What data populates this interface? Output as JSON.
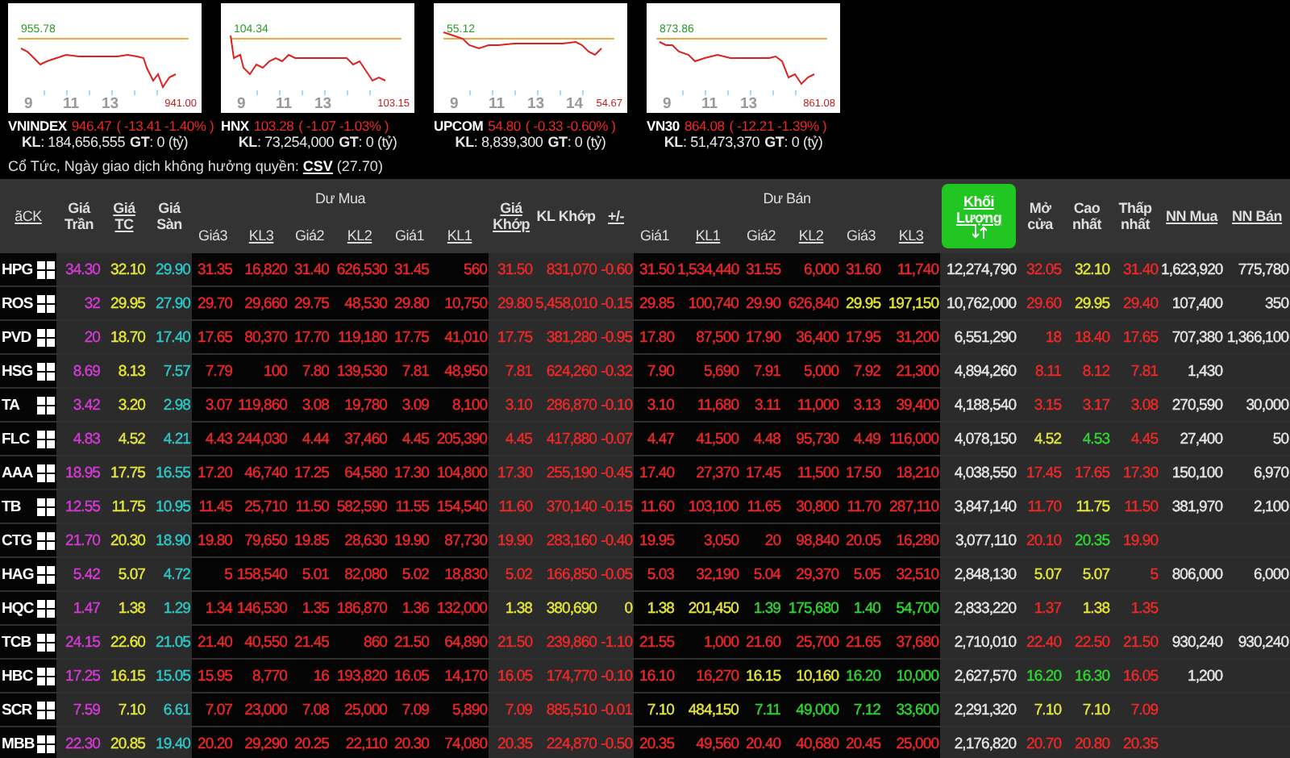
{
  "indices": [
    {
      "name": "VNINDEX",
      "value": "946.47",
      "change": "( -13.41  -1.40% )",
      "volume": "**KL**: 184,656,555",
      "turnover": "**GT**: 0 (tỷ)",
      "high": "955.78",
      "low": "941.00",
      "ticks": [
        "9",
        "11",
        "13"
      ]
    },
    {
      "name": "HNX",
      "value": "103.28",
      "change": "( -1.07  -1.03% )",
      "volume": "**KL**: 73,254,000",
      "turnover": "**GT**: 0 (tỷ)",
      "high": "104.34",
      "low": "103.15",
      "ticks": [
        "9",
        "11",
        "13"
      ]
    },
    {
      "name": "UPCOM",
      "value": "54.80",
      "change": "( -0.33  -0.60% )",
      "volume": "**KL**: 8,839,300",
      "turnover": "**GT**: 0 (tỷ)",
      "high": "55.12",
      "low": "54.67",
      "ticks": [
        "9",
        "11",
        "13",
        "14"
      ]
    },
    {
      "name": "VN30",
      "value": "864.08",
      "change": "( -12.21  -1.39% )",
      "volume": "**KL**: 51,473,370",
      "turnover": "**GT**: 0 (tỷ)",
      "high": "873.86",
      "low": "861.08",
      "ticks": [
        "9",
        "11",
        "13"
      ]
    }
  ],
  "notice": {
    "text": "Cổ Tức, Ngày giao dịch không hưởng quyền:",
    "link": "CSV",
    "after": "(27.70)"
  },
  "table": {
    "header": [
      {
        "kind": "ticker",
        "label": "ãCK",
        "link": true,
        "sorted": false
      },
      {
        "kind": "single",
        "label": "Giá Trần",
        "link": false,
        "sorted": false
      },
      {
        "kind": "single",
        "label": "Giá TC",
        "link": true,
        "sorted": false
      },
      {
        "kind": "single",
        "label": "Giá Sàn",
        "link": false,
        "sorted": false
      },
      {
        "kind": "group",
        "label": "Dư Mua",
        "sub": [
          {
            "label": "Giá3",
            "link": false
          },
          {
            "label": "KL3",
            "link": true
          },
          {
            "label": "Giá2",
            "link": false
          },
          {
            "label": "KL2",
            "link": true
          },
          {
            "label": "Giá1",
            "link": false
          },
          {
            "label": "KL1",
            "link": true
          }
        ]
      },
      {
        "kind": "single",
        "label": "Giá Khớp",
        "link": true,
        "sorted": false
      },
      {
        "kind": "single",
        "label": "KL Khớp",
        "link": false,
        "sorted": false
      },
      {
        "kind": "single",
        "label": "+/-",
        "link": true,
        "sorted": false
      },
      {
        "kind": "group",
        "label": "Dư Bán",
        "sub": [
          {
            "label": "Giá1",
            "link": false
          },
          {
            "label": "KL1",
            "link": true
          },
          {
            "label": "Giá2",
            "link": false
          },
          {
            "label": "KL2",
            "link": true
          },
          {
            "label": "Giá3",
            "link": false
          },
          {
            "label": "KL3",
            "link": true
          }
        ]
      },
      {
        "kind": "single",
        "label": "Khối Lượng",
        "link": true,
        "sorted": true
      },
      {
        "kind": "single",
        "label": "Mở cửa",
        "link": false,
        "sorted": false
      },
      {
        "kind": "single",
        "label": "Cao nhất",
        "link": false,
        "sorted": false
      },
      {
        "kind": "single",
        "label": "Thấp nhất",
        "link": false,
        "sorted": false
      },
      {
        "kind": "single",
        "label": "NN Mua",
        "link": true,
        "sorted": false
      },
      {
        "kind": "single",
        "label": "NN Bán",
        "link": true,
        "sorted": false
      }
    ],
    "rows": [
      {
        "ticker": "HPG",
        "cells": [
          {
            "text": "34.30",
            "color": "#d63ad6"
          },
          {
            "text": "32.10",
            "color": "#e6e63c"
          },
          {
            "text": "29.90",
            "color": "#2ec8c8"
          },
          {
            "text": "31.35",
            "color": "#f02828"
          },
          {
            "text": "16,820",
            "color": "#f02828"
          },
          {
            "text": "31.40",
            "color": "#f02828"
          },
          {
            "text": "626,530",
            "color": "#f02828"
          },
          {
            "text": "31.45",
            "color": "#f02828"
          },
          {
            "text": "560",
            "color": "#f02828"
          },
          {
            "text": "31.50",
            "color": "#f02828"
          },
          {
            "text": "831,070",
            "color": "#f02828"
          },
          {
            "text": "-0.60",
            "color": "#f02828"
          },
          {
            "text": "31.50",
            "color": "#f02828"
          },
          {
            "text": "1,534,440",
            "color": "#f02828"
          },
          {
            "text": "31.55",
            "color": "#f02828"
          },
          {
            "text": "6,000",
            "color": "#f02828"
          },
          {
            "text": "31.60",
            "color": "#f02828"
          },
          {
            "text": "11,740",
            "color": "#f02828"
          },
          {
            "text": "12,274,790",
            "color": "#e6e6e6"
          },
          {
            "text": "32.05",
            "color": "#f02828"
          },
          {
            "text": "32.10",
            "color": "#e6e63c"
          },
          {
            "text": "31.40",
            "color": "#f02828"
          },
          {
            "text": "1,623,920",
            "color": "#e6e6e6"
          },
          {
            "text": "775,780",
            "color": "#e6e6e6"
          }
        ]
      },
      {
        "ticker": "ROS",
        "cells": [
          {
            "text": "32",
            "color": "#d63ad6"
          },
          {
            "text": "29.95",
            "color": "#e6e63c"
          },
          {
            "text": "27.90",
            "color": "#2ec8c8"
          },
          {
            "text": "29.70",
            "color": "#f02828"
          },
          {
            "text": "29,660",
            "color": "#f02828"
          },
          {
            "text": "29.75",
            "color": "#f02828"
          },
          {
            "text": "48,530",
            "color": "#f02828"
          },
          {
            "text": "29.80",
            "color": "#f02828"
          },
          {
            "text": "10,750",
            "color": "#f02828"
          },
          {
            "text": "29.80",
            "color": "#f02828"
          },
          {
            "text": "5,458,010",
            "color": "#f02828"
          },
          {
            "text": "-0.15",
            "color": "#f02828"
          },
          {
            "text": "29.85",
            "color": "#f02828"
          },
          {
            "text": "100,740",
            "color": "#f02828"
          },
          {
            "text": "29.90",
            "color": "#f02828"
          },
          {
            "text": "626,840",
            "color": "#f02828"
          },
          {
            "text": "29.95",
            "color": "#e6e63c"
          },
          {
            "text": "197,150",
            "color": "#e6e63c"
          },
          {
            "text": "10,762,000",
            "color": "#e6e6e6"
          },
          {
            "text": "29.60",
            "color": "#f02828"
          },
          {
            "text": "29.95",
            "color": "#e6e63c"
          },
          {
            "text": "29.40",
            "color": "#f02828"
          },
          {
            "text": "107,400",
            "color": "#e6e6e6"
          },
          {
            "text": "350",
            "color": "#e6e6e6"
          }
        ]
      },
      {
        "ticker": "PVD",
        "cells": [
          {
            "text": "20",
            "color": "#d63ad6"
          },
          {
            "text": "18.70",
            "color": "#e6e63c"
          },
          {
            "text": "17.40",
            "color": "#2ec8c8"
          },
          {
            "text": "17.65",
            "color": "#f02828"
          },
          {
            "text": "80,370",
            "color": "#f02828"
          },
          {
            "text": "17.70",
            "color": "#f02828"
          },
          {
            "text": "119,180",
            "color": "#f02828"
          },
          {
            "text": "17.75",
            "color": "#f02828"
          },
          {
            "text": "41,010",
            "color": "#f02828"
          },
          {
            "text": "17.75",
            "color": "#f02828"
          },
          {
            "text": "381,280",
            "color": "#f02828"
          },
          {
            "text": "-0.95",
            "color": "#f02828"
          },
          {
            "text": "17.80",
            "color": "#f02828"
          },
          {
            "text": "87,500",
            "color": "#f02828"
          },
          {
            "text": "17.90",
            "color": "#f02828"
          },
          {
            "text": "36,400",
            "color": "#f02828"
          },
          {
            "text": "17.95",
            "color": "#f02828"
          },
          {
            "text": "31,200",
            "color": "#f02828"
          },
          {
            "text": "6,551,290",
            "color": "#e6e6e6"
          },
          {
            "text": "18",
            "color": "#f02828"
          },
          {
            "text": "18.40",
            "color": "#f02828"
          },
          {
            "text": "17.65",
            "color": "#f02828"
          },
          {
            "text": "707,380",
            "color": "#e6e6e6"
          },
          {
            "text": "1,366,100",
            "color": "#e6e6e6"
          }
        ]
      },
      {
        "ticker": "HSG",
        "cells": [
          {
            "text": "8.69",
            "color": "#d63ad6"
          },
          {
            "text": "8.13",
            "color": "#e6e63c"
          },
          {
            "text": "7.57",
            "color": "#2ec8c8"
          },
          {
            "text": "7.79",
            "color": "#f02828"
          },
          {
            "text": "100",
            "color": "#f02828"
          },
          {
            "text": "7.80",
            "color": "#f02828"
          },
          {
            "text": "139,530",
            "color": "#f02828"
          },
          {
            "text": "7.81",
            "color": "#f02828"
          },
          {
            "text": "48,950",
            "color": "#f02828"
          },
          {
            "text": "7.81",
            "color": "#f02828"
          },
          {
            "text": "624,260",
            "color": "#f02828"
          },
          {
            "text": "-0.32",
            "color": "#f02828"
          },
          {
            "text": "7.90",
            "color": "#f02828"
          },
          {
            "text": "5,690",
            "color": "#f02828"
          },
          {
            "text": "7.91",
            "color": "#f02828"
          },
          {
            "text": "5,000",
            "color": "#f02828"
          },
          {
            "text": "7.92",
            "color": "#f02828"
          },
          {
            "text": "21,300",
            "color": "#f02828"
          },
          {
            "text": "4,894,260",
            "color": "#e6e6e6"
          },
          {
            "text": "8.11",
            "color": "#f02828"
          },
          {
            "text": "8.12",
            "color": "#f02828"
          },
          {
            "text": "7.81",
            "color": "#f02828"
          },
          {
            "text": "1,430",
            "color": "#e6e6e6"
          },
          null
        ]
      },
      {
        "ticker": "TA",
        "cells": [
          {
            "text": "3.42",
            "color": "#d63ad6"
          },
          {
            "text": "3.20",
            "color": "#e6e63c"
          },
          {
            "text": "2.98",
            "color": "#2ec8c8"
          },
          {
            "text": "3.07",
            "color": "#f02828"
          },
          {
            "text": "119,860",
            "color": "#f02828"
          },
          {
            "text": "3.08",
            "color": "#f02828"
          },
          {
            "text": "19,780",
            "color": "#f02828"
          },
          {
            "text": "3.09",
            "color": "#f02828"
          },
          {
            "text": "8,100",
            "color": "#f02828"
          },
          {
            "text": "3.10",
            "color": "#f02828"
          },
          {
            "text": "286,870",
            "color": "#f02828"
          },
          {
            "text": "-0.10",
            "color": "#f02828"
          },
          {
            "text": "3.10",
            "color": "#f02828"
          },
          {
            "text": "11,680",
            "color": "#f02828"
          },
          {
            "text": "3.11",
            "color": "#f02828"
          },
          {
            "text": "11,000",
            "color": "#f02828"
          },
          {
            "text": "3.13",
            "color": "#f02828"
          },
          {
            "text": "39,400",
            "color": "#f02828"
          },
          {
            "text": "4,188,540",
            "color": "#e6e6e6"
          },
          {
            "text": "3.15",
            "color": "#f02828"
          },
          {
            "text": "3.17",
            "color": "#f02828"
          },
          {
            "text": "3.08",
            "color": "#f02828"
          },
          {
            "text": "270,590",
            "color": "#e6e6e6"
          },
          {
            "text": "30,000",
            "color": "#e6e6e6"
          }
        ]
      },
      {
        "ticker": "FLC",
        "cells": [
          {
            "text": "4.83",
            "color": "#d63ad6"
          },
          {
            "text": "4.52",
            "color": "#e6e63c"
          },
          {
            "text": "4.21",
            "color": "#2ec8c8"
          },
          {
            "text": "4.43",
            "color": "#f02828"
          },
          {
            "text": "244,030",
            "color": "#f02828"
          },
          {
            "text": "4.44",
            "color": "#f02828"
          },
          {
            "text": "37,460",
            "color": "#f02828"
          },
          {
            "text": "4.45",
            "color": "#f02828"
          },
          {
            "text": "205,390",
            "color": "#f02828"
          },
          {
            "text": "4.45",
            "color": "#f02828"
          },
          {
            "text": "417,880",
            "color": "#f02828"
          },
          {
            "text": "-0.07",
            "color": "#f02828"
          },
          {
            "text": "4.47",
            "color": "#f02828"
          },
          {
            "text": "41,500",
            "color": "#f02828"
          },
          {
            "text": "4.48",
            "color": "#f02828"
          },
          {
            "text": "95,730",
            "color": "#f02828"
          },
          {
            "text": "4.49",
            "color": "#f02828"
          },
          {
            "text": "116,000",
            "color": "#f02828"
          },
          {
            "text": "4,078,150",
            "color": "#e6e6e6"
          },
          {
            "text": "4.52",
            "color": "#e6e63c"
          },
          {
            "text": "4.53",
            "color": "#2fd82f"
          },
          {
            "text": "4.45",
            "color": "#f02828"
          },
          {
            "text": "27,400",
            "color": "#e6e6e6"
          },
          {
            "text": "50",
            "color": "#e6e6e6"
          }
        ]
      },
      {
        "ticker": "AAA",
        "cells": [
          {
            "text": "18.95",
            "color": "#d63ad6"
          },
          {
            "text": "17.75",
            "color": "#e6e63c"
          },
          {
            "text": "16.55",
            "color": "#2ec8c8"
          },
          {
            "text": "17.20",
            "color": "#f02828"
          },
          {
            "text": "46,740",
            "color": "#f02828"
          },
          {
            "text": "17.25",
            "color": "#f02828"
          },
          {
            "text": "64,580",
            "color": "#f02828"
          },
          {
            "text": "17.30",
            "color": "#f02828"
          },
          {
            "text": "104,800",
            "color": "#f02828"
          },
          {
            "text": "17.30",
            "color": "#f02828"
          },
          {
            "text": "255,190",
            "color": "#f02828"
          },
          {
            "text": "-0.45",
            "color": "#f02828"
          },
          {
            "text": "17.40",
            "color": "#f02828"
          },
          {
            "text": "27,370",
            "color": "#f02828"
          },
          {
            "text": "17.45",
            "color": "#f02828"
          },
          {
            "text": "11,500",
            "color": "#f02828"
          },
          {
            "text": "17.50",
            "color": "#f02828"
          },
          {
            "text": "18,210",
            "color": "#f02828"
          },
          {
            "text": "4,038,550",
            "color": "#e6e6e6"
          },
          {
            "text": "17.45",
            "color": "#f02828"
          },
          {
            "text": "17.65",
            "color": "#f02828"
          },
          {
            "text": "17.30",
            "color": "#f02828"
          },
          {
            "text": "150,100",
            "color": "#e6e6e6"
          },
          {
            "text": "6,970",
            "color": "#e6e6e6"
          }
        ]
      },
      {
        "ticker": "TB",
        "cells": [
          {
            "text": "12.55",
            "color": "#d63ad6"
          },
          {
            "text": "11.75",
            "color": "#e6e63c"
          },
          {
            "text": "10.95",
            "color": "#2ec8c8"
          },
          {
            "text": "11.45",
            "color": "#f02828"
          },
          {
            "text": "25,710",
            "color": "#f02828"
          },
          {
            "text": "11.50",
            "color": "#f02828"
          },
          {
            "text": "582,590",
            "color": "#f02828"
          },
          {
            "text": "11.55",
            "color": "#f02828"
          },
          {
            "text": "154,540",
            "color": "#f02828"
          },
          {
            "text": "11.60",
            "color": "#f02828"
          },
          {
            "text": "370,140",
            "color": "#f02828"
          },
          {
            "text": "-0.15",
            "color": "#f02828"
          },
          {
            "text": "11.60",
            "color": "#f02828"
          },
          {
            "text": "103,100",
            "color": "#f02828"
          },
          {
            "text": "11.65",
            "color": "#f02828"
          },
          {
            "text": "30,800",
            "color": "#f02828"
          },
          {
            "text": "11.70",
            "color": "#f02828"
          },
          {
            "text": "287,110",
            "color": "#f02828"
          },
          {
            "text": "3,847,140",
            "color": "#e6e6e6"
          },
          {
            "text": "11.70",
            "color": "#f02828"
          },
          {
            "text": "11.75",
            "color": "#e6e63c"
          },
          {
            "text": "11.50",
            "color": "#f02828"
          },
          {
            "text": "381,970",
            "color": "#e6e6e6"
          },
          {
            "text": "2,100",
            "color": "#e6e6e6"
          }
        ]
      },
      {
        "ticker": "CTG",
        "cells": [
          {
            "text": "21.70",
            "color": "#d63ad6"
          },
          {
            "text": "20.30",
            "color": "#e6e63c"
          },
          {
            "text": "18.90",
            "color": "#2ec8c8"
          },
          {
            "text": "19.80",
            "color": "#f02828"
          },
          {
            "text": "79,650",
            "color": "#f02828"
          },
          {
            "text": "19.85",
            "color": "#f02828"
          },
          {
            "text": "28,630",
            "color": "#f02828"
          },
          {
            "text": "19.90",
            "color": "#f02828"
          },
          {
            "text": "87,730",
            "color": "#f02828"
          },
          {
            "text": "19.90",
            "color": "#f02828"
          },
          {
            "text": "283,160",
            "color": "#f02828"
          },
          {
            "text": "-0.40",
            "color": "#f02828"
          },
          {
            "text": "19.95",
            "color": "#f02828"
          },
          {
            "text": "3,050",
            "color": "#f02828"
          },
          {
            "text": "20",
            "color": "#f02828"
          },
          {
            "text": "98,840",
            "color": "#f02828"
          },
          {
            "text": "20.05",
            "color": "#f02828"
          },
          {
            "text": "16,280",
            "color": "#f02828"
          },
          {
            "text": "3,077,110",
            "color": "#e6e6e6"
          },
          {
            "text": "20.10",
            "color": "#f02828"
          },
          {
            "text": "20.35",
            "color": "#2fd82f"
          },
          {
            "text": "19.90",
            "color": "#f02828"
          },
          null,
          null
        ]
      },
      {
        "ticker": "HAG",
        "cells": [
          {
            "text": "5.42",
            "color": "#d63ad6"
          },
          {
            "text": "5.07",
            "color": "#e6e63c"
          },
          {
            "text": "4.72",
            "color": "#2ec8c8"
          },
          {
            "text": "5",
            "color": "#f02828"
          },
          {
            "text": "158,540",
            "color": "#f02828"
          },
          {
            "text": "5.01",
            "color": "#f02828"
          },
          {
            "text": "82,080",
            "color": "#f02828"
          },
          {
            "text": "5.02",
            "color": "#f02828"
          },
          {
            "text": "18,830",
            "color": "#f02828"
          },
          {
            "text": "5.02",
            "color": "#f02828"
          },
          {
            "text": "166,850",
            "color": "#f02828"
          },
          {
            "text": "-0.05",
            "color": "#f02828"
          },
          {
            "text": "5.03",
            "color": "#f02828"
          },
          {
            "text": "32,190",
            "color": "#f02828"
          },
          {
            "text": "5.04",
            "color": "#f02828"
          },
          {
            "text": "29,370",
            "color": "#f02828"
          },
          {
            "text": "5.05",
            "color": "#f02828"
          },
          {
            "text": "32,510",
            "color": "#f02828"
          },
          {
            "text": "2,848,130",
            "color": "#e6e6e6"
          },
          {
            "text": "5.07",
            "color": "#e6e63c"
          },
          {
            "text": "5.07",
            "color": "#e6e63c"
          },
          {
            "text": "5",
            "color": "#f02828"
          },
          {
            "text": "806,000",
            "color": "#e6e6e6"
          },
          {
            "text": "6,000",
            "color": "#e6e6e6"
          }
        ]
      },
      {
        "ticker": "HQC",
        "cells": [
          {
            "text": "1.47",
            "color": "#d63ad6"
          },
          {
            "text": "1.38",
            "color": "#e6e63c"
          },
          {
            "text": "1.29",
            "color": "#2ec8c8"
          },
          {
            "text": "1.34",
            "color": "#f02828"
          },
          {
            "text": "146,530",
            "color": "#f02828"
          },
          {
            "text": "1.35",
            "color": "#f02828"
          },
          {
            "text": "186,870",
            "color": "#f02828"
          },
          {
            "text": "1.36",
            "color": "#f02828"
          },
          {
            "text": "132,000",
            "color": "#f02828"
          },
          {
            "text": "1.38",
            "color": "#e6e63c"
          },
          {
            "text": "380,690",
            "color": "#e6e63c"
          },
          {
            "text": "0",
            "color": "#e6e63c"
          },
          {
            "text": "1.38",
            "color": "#e6e63c"
          },
          {
            "text": "201,450",
            "color": "#e6e63c"
          },
          {
            "text": "1.39",
            "color": "#2fd82f"
          },
          {
            "text": "175,680",
            "color": "#2fd82f"
          },
          {
            "text": "1.40",
            "color": "#2fd82f"
          },
          {
            "text": "54,700",
            "color": "#2fd82f"
          },
          {
            "text": "2,833,220",
            "color": "#e6e6e6"
          },
          {
            "text": "1.37",
            "color": "#f02828"
          },
          {
            "text": "1.38",
            "color": "#e6e63c"
          },
          {
            "text": "1.35",
            "color": "#f02828"
          },
          null,
          null
        ]
      },
      {
        "ticker": "TCB",
        "cells": [
          {
            "text": "24.15",
            "color": "#d63ad6"
          },
          {
            "text": "22.60",
            "color": "#e6e63c"
          },
          {
            "text": "21.05",
            "color": "#2ec8c8"
          },
          {
            "text": "21.40",
            "color": "#f02828"
          },
          {
            "text": "40,550",
            "color": "#f02828"
          },
          {
            "text": "21.45",
            "color": "#f02828"
          },
          {
            "text": "860",
            "color": "#f02828"
          },
          {
            "text": "21.50",
            "color": "#f02828"
          },
          {
            "text": "64,890",
            "color": "#f02828"
          },
          {
            "text": "21.50",
            "color": "#f02828"
          },
          {
            "text": "239,860",
            "color": "#f02828"
          },
          {
            "text": "-1.10",
            "color": "#f02828"
          },
          {
            "text": "21.55",
            "color": "#f02828"
          },
          {
            "text": "1,000",
            "color": "#f02828"
          },
          {
            "text": "21.60",
            "color": "#f02828"
          },
          {
            "text": "25,700",
            "color": "#f02828"
          },
          {
            "text": "21.65",
            "color": "#f02828"
          },
          {
            "text": "37,680",
            "color": "#f02828"
          },
          {
            "text": "2,710,010",
            "color": "#e6e6e6"
          },
          {
            "text": "22.40",
            "color": "#f02828"
          },
          {
            "text": "22.50",
            "color": "#f02828"
          },
          {
            "text": "21.50",
            "color": "#f02828"
          },
          {
            "text": "930,240",
            "color": "#e6e6e6"
          },
          {
            "text": "930,240",
            "color": "#e6e6e6"
          }
        ]
      },
      {
        "ticker": "HBC",
        "cells": [
          {
            "text": "17.25",
            "color": "#d63ad6"
          },
          {
            "text": "16.15",
            "color": "#e6e63c"
          },
          {
            "text": "15.05",
            "color": "#2ec8c8"
          },
          {
            "text": "15.95",
            "color": "#f02828"
          },
          {
            "text": "8,770",
            "color": "#f02828"
          },
          {
            "text": "16",
            "color": "#f02828"
          },
          {
            "text": "193,820",
            "color": "#f02828"
          },
          {
            "text": "16.05",
            "color": "#f02828"
          },
          {
            "text": "14,170",
            "color": "#f02828"
          },
          {
            "text": "16.05",
            "color": "#f02828"
          },
          {
            "text": "174,770",
            "color": "#f02828"
          },
          {
            "text": "-0.10",
            "color": "#f02828"
          },
          {
            "text": "16.10",
            "color": "#f02828"
          },
          {
            "text": "16,270",
            "color": "#f02828"
          },
          {
            "text": "16.15",
            "color": "#e6e63c"
          },
          {
            "text": "10,160",
            "color": "#e6e63c"
          },
          {
            "text": "16.20",
            "color": "#2fd82f"
          },
          {
            "text": "10,000",
            "color": "#2fd82f"
          },
          {
            "text": "2,627,570",
            "color": "#e6e6e6"
          },
          {
            "text": "16.20",
            "color": "#2fd82f"
          },
          {
            "text": "16.30",
            "color": "#2fd82f"
          },
          {
            "text": "16.05",
            "color": "#f02828"
          },
          {
            "text": "1,200",
            "color": "#e6e6e6"
          },
          null
        ]
      },
      {
        "ticker": "SCR",
        "cells": [
          {
            "text": "7.59",
            "color": "#d63ad6"
          },
          {
            "text": "7.10",
            "color": "#e6e63c"
          },
          {
            "text": "6.61",
            "color": "#2ec8c8"
          },
          {
            "text": "7.07",
            "color": "#f02828"
          },
          {
            "text": "23,000",
            "color": "#f02828"
          },
          {
            "text": "7.08",
            "color": "#f02828"
          },
          {
            "text": "25,000",
            "color": "#f02828"
          },
          {
            "text": "7.09",
            "color": "#f02828"
          },
          {
            "text": "5,890",
            "color": "#f02828"
          },
          {
            "text": "7.09",
            "color": "#f02828"
          },
          {
            "text": "885,510",
            "color": "#f02828"
          },
          {
            "text": "-0.01",
            "color": "#f02828"
          },
          {
            "text": "7.10",
            "color": "#e6e63c"
          },
          {
            "text": "484,150",
            "color": "#e6e63c"
          },
          {
            "text": "7.11",
            "color": "#2fd82f"
          },
          {
            "text": "49,000",
            "color": "#2fd82f"
          },
          {
            "text": "7.12",
            "color": "#2fd82f"
          },
          {
            "text": "33,600",
            "color": "#2fd82f"
          },
          {
            "text": "2,291,320",
            "color": "#e6e6e6"
          },
          {
            "text": "7.10",
            "color": "#e6e63c"
          },
          {
            "text": "7.10",
            "color": "#e6e63c"
          },
          {
            "text": "7.09",
            "color": "#f02828"
          },
          null,
          null
        ]
      },
      {
        "ticker": "MBB",
        "cells": [
          {
            "text": "22.30",
            "color": "#d63ad6"
          },
          {
            "text": "20.85",
            "color": "#e6e63c"
          },
          {
            "text": "19.40",
            "color": "#2ec8c8"
          },
          {
            "text": "20.20",
            "color": "#f02828"
          },
          {
            "text": "29,290",
            "color": "#f02828"
          },
          {
            "text": "20.25",
            "color": "#f02828"
          },
          {
            "text": "22,110",
            "color": "#f02828"
          },
          {
            "text": "20.30",
            "color": "#f02828"
          },
          {
            "text": "74,080",
            "color": "#f02828"
          },
          {
            "text": "20.35",
            "color": "#f02828"
          },
          {
            "text": "224,870",
            "color": "#f02828"
          },
          {
            "text": "-0.50",
            "color": "#f02828"
          },
          {
            "text": "20.35",
            "color": "#f02828"
          },
          {
            "text": "49,560",
            "color": "#f02828"
          },
          {
            "text": "20.40",
            "color": "#f02828"
          },
          {
            "text": "40,680",
            "color": "#f02828"
          },
          {
            "text": "20.45",
            "color": "#f02828"
          },
          {
            "text": "25,000",
            "color": "#f02828"
          },
          {
            "text": "2,176,820",
            "color": "#e6e6e6"
          },
          {
            "text": "20.70",
            "color": "#f02828"
          },
          {
            "text": "20.80",
            "color": "#f02828"
          },
          {
            "text": "20.35",
            "color": "#f02828"
          },
          null,
          null
        ]
      }
    ]
  }
}
